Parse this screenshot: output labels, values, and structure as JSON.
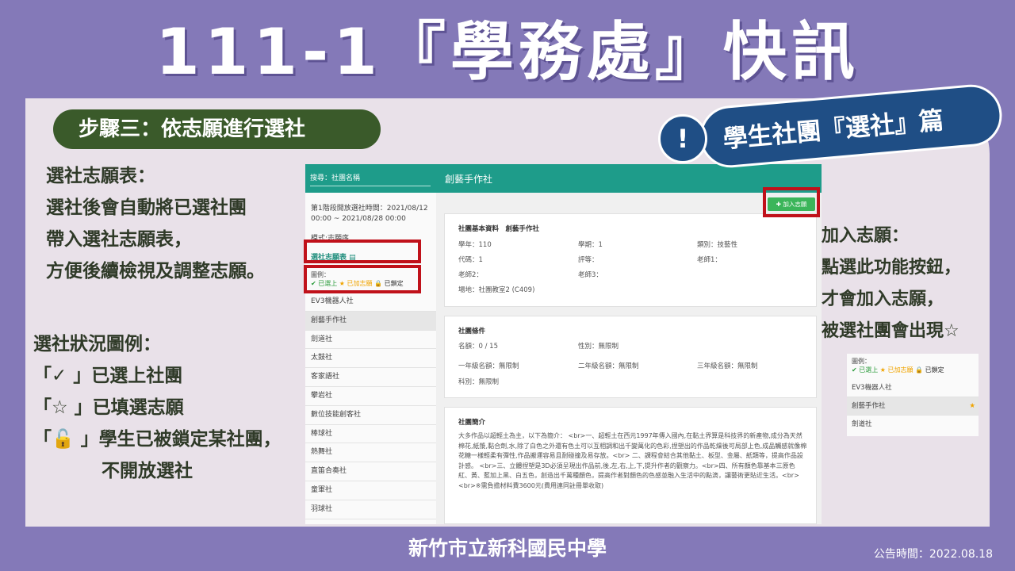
{
  "title": "111-1『學務處』快訊",
  "step_label": "步驟三：依志願進行選社",
  "badge": {
    "mark": "!",
    "text": "學生社團『選社』篇"
  },
  "left_intro": [
    "選社志願表：",
    "選社後會自動將已選社團",
    "帶入選社志願表，",
    "方便後續檢視及調整志願。"
  ],
  "legend_title": "選社狀況圖例：",
  "legend_lines": [
    "「✓ 」已選上社團",
    "「☆ 」已填選志願",
    "「🔓 」學生已被鎖定某社團，",
    "不開放選社"
  ],
  "right_text": [
    "加入志願：",
    "點選此功能按鈕，",
    "才會加入志願，",
    "被選社團會出現☆"
  ],
  "screenshot": {
    "search_label": "搜尋：社團名稱",
    "club_title": "創藝手作社",
    "phase_time": "第1階段開放選社時間：2021/08/12 00:00 ~ 2021/08/28 00:00",
    "mode": "模式:志願序",
    "wishlist_link": "選社志願表 ▤",
    "legend_label": "圖例：",
    "legend_selected": "✔ 已選上",
    "legend_added": "★ 已加志願",
    "legend_locked": "🔒 已鎖定",
    "clubs": [
      "EV3機器人社",
      "創藝手作社",
      "劍道社",
      "太鼓社",
      "客家語社",
      "攀岩社",
      "數位技能創客社",
      "棒球社",
      "熱舞社",
      "直笛合奏社",
      "童軍社",
      "羽球社"
    ],
    "active_club_index": 1,
    "add_button": "✚ 加入志願",
    "basic": {
      "header": "社團基本資料　創藝手作社",
      "year": "學年：110",
      "semester": "學期：1",
      "category": "類別：技藝性",
      "code": "代碼：1",
      "grading": "評等：",
      "teacher1": "老師1：",
      "teacher2": "老師2：",
      "teacher3": "老師3：",
      "venue": "場地：社團教室2 (C409)"
    },
    "conditions": {
      "header": "社團條件",
      "quota": "名額：0 / 15",
      "gender": "性別：無限制",
      "grade1": "一年級名額：無限制",
      "grade2": "二年級名額：無限制",
      "grade3": "三年級名額：無限制",
      "dept": "科別：無限制"
    },
    "intro": {
      "header": "社團簡介",
      "text": "大多作品以超輕土為主，以下為簡介：\n<br>一、超輕土在西元1997年傳入國內,在黏土界算是科技界的新產物,成分為天然棉花,紙漿,黏合劑,水,除了白色之外還有色土可以互相調和出千變萬化的色彩,捏塑出的作品乾燥後可局部上色,成品觸感就像棉花糖一樣輕柔有彈性,作品搬運容易且耐碰撞及易存放。<br>\n二、課程會結合其他黏土、板型、金屬、紙類等，提高作品設計感。\n<br>三、立體捏塑是3D必須呈現出作品前,後,左,右,上,下,提升作者的觀察力。<br>四、所有顏色靠基本三原色紅、黃、藍加上黑、白五色，創造出千萬種顏色，提高作者對顏色的色感並融入生活中的點滴，讓藝術更貼近生活。<br><br>※需負擔材料費3600元(費用連同註冊單收取)"
    }
  },
  "legend_snippet": {
    "label": "圖例：",
    "selected": "✔ 已選上",
    "added": "★ 已加志願",
    "locked": "🔒 已鎖定",
    "items": [
      "EV3機器人社",
      "創藝手作社",
      "劍道社"
    ],
    "star": "★"
  },
  "footer": "新竹市立新科國民中學",
  "announce_date": "公告時間：2022.08.18",
  "colors": {
    "background": "#8479b8",
    "panel": "#e9e1e9",
    "step_pill": "#3a5a2a",
    "badge": "#1f4e85",
    "topbar": "#1e9c8a",
    "highlight": "#c0111a",
    "add_button": "#3bb55a"
  }
}
